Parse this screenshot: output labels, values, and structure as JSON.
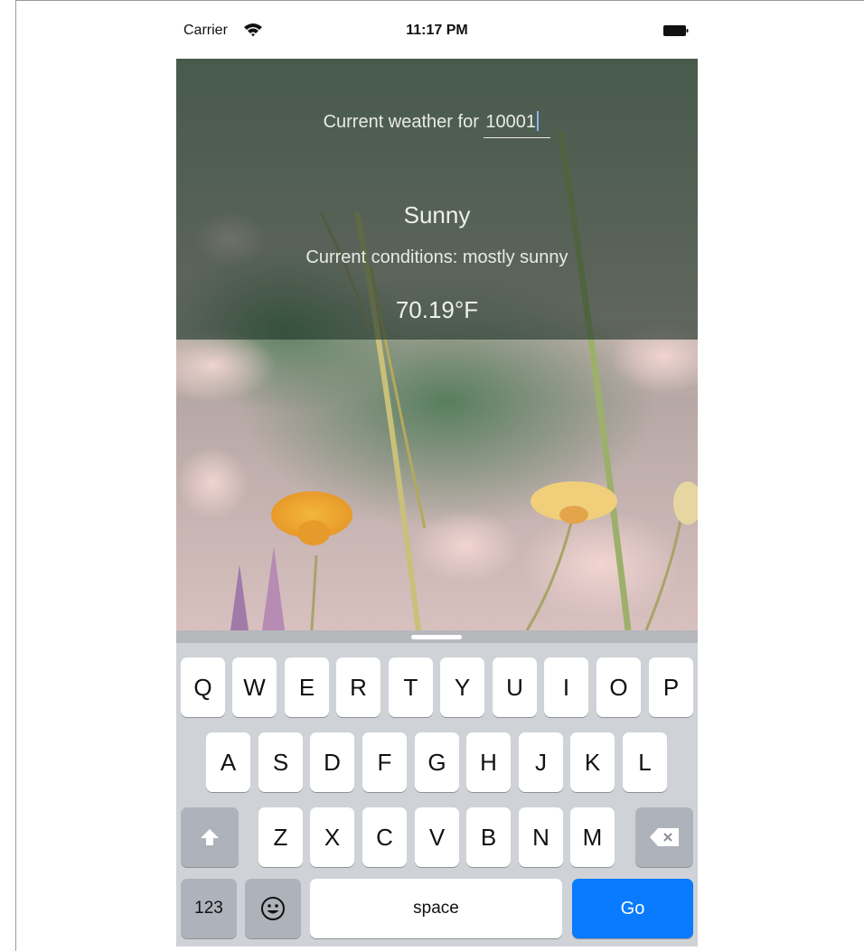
{
  "status_bar": {
    "carrier": "Carrier",
    "time": "11:17 PM"
  },
  "weather": {
    "title_prefix": "Current weather for ",
    "zip_value": "10001",
    "summary": "Sunny",
    "conditions": "Current conditions: mostly sunny",
    "temperature": "70.19°F"
  },
  "keyboard": {
    "row1": [
      "Q",
      "W",
      "E",
      "R",
      "T",
      "Y",
      "U",
      "I",
      "O",
      "P"
    ],
    "row2": [
      "A",
      "S",
      "D",
      "F",
      "G",
      "H",
      "J",
      "K",
      "L"
    ],
    "row3": [
      "Z",
      "X",
      "C",
      "V",
      "B",
      "N",
      "M"
    ],
    "numbers_label": "123",
    "space_label": "space",
    "go_label": "Go"
  },
  "colors": {
    "go_key": "#0a7bff",
    "overlay": "#1e3428"
  }
}
